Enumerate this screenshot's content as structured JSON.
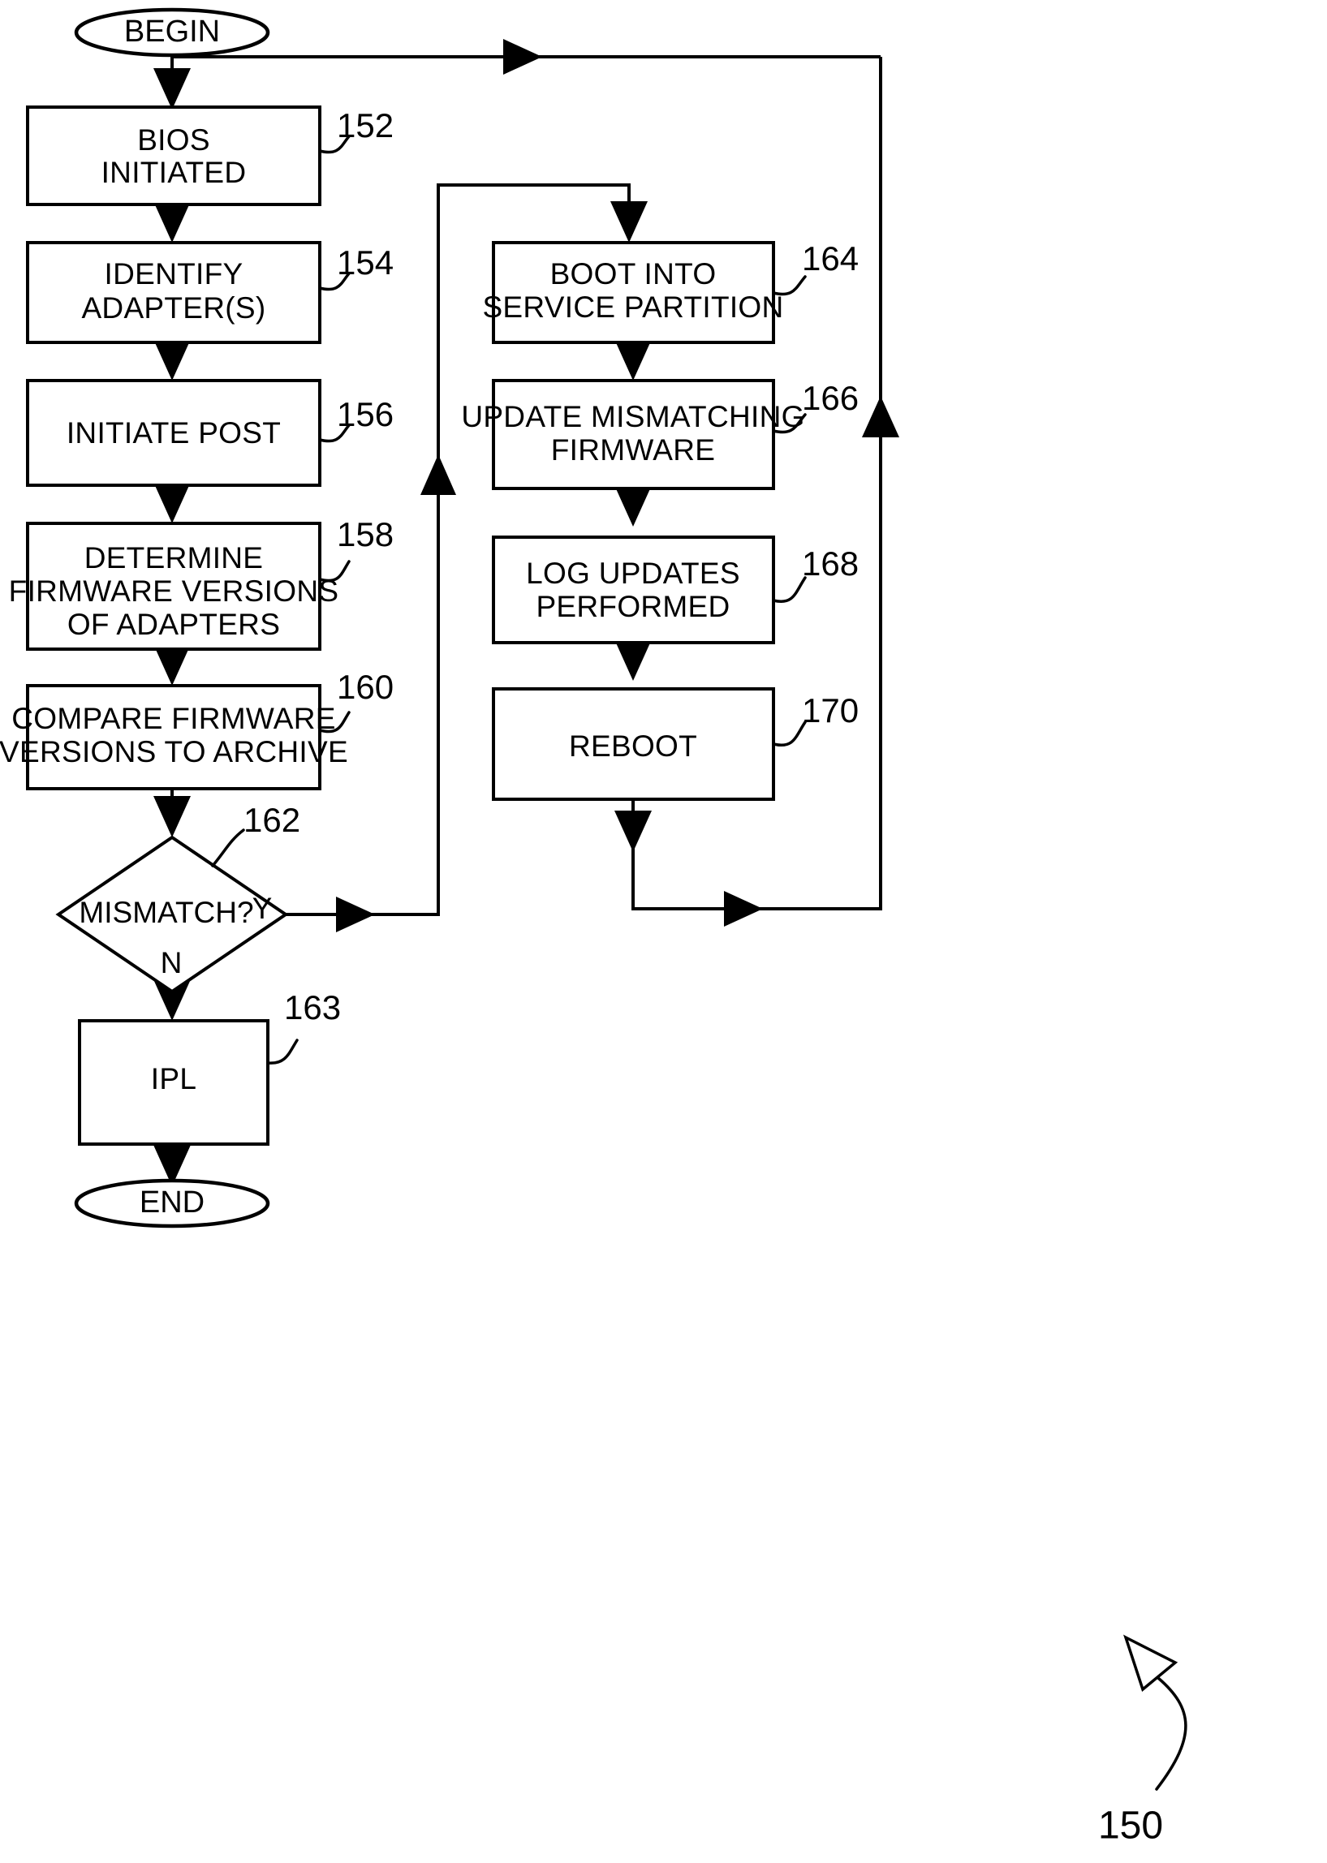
{
  "figure": {
    "number": "150",
    "type": "flowchart"
  },
  "terminators": {
    "begin": "BEGIN",
    "end": "END"
  },
  "left_column": [
    {
      "id": "152",
      "lines": [
        "BIOS",
        "INITIATED"
      ],
      "ref": "152"
    },
    {
      "id": "154",
      "lines": [
        "IDENTIFY",
        "ADAPTER(S)"
      ],
      "ref": "154"
    },
    {
      "id": "156",
      "lines": [
        "INITIATE POST"
      ],
      "ref": "156"
    },
    {
      "id": "158",
      "lines": [
        "DETERMINE",
        "FIRMWARE VERSIONS",
        "OF ADAPTERS"
      ],
      "ref": "158"
    },
    {
      "id": "160",
      "lines": [
        "COMPARE FIRMWARE",
        "VERSIONS TO ARCHIVE"
      ],
      "ref": "160"
    },
    {
      "id": "163",
      "lines": [
        "IPL"
      ],
      "ref": "163"
    }
  ],
  "decision": {
    "ref": "162",
    "question": "MISMATCH?",
    "yes_label": "Y",
    "no_label": "N"
  },
  "right_column": [
    {
      "id": "164",
      "lines": [
        "BOOT INTO",
        "SERVICE PARTITION"
      ],
      "ref": "164"
    },
    {
      "id": "166",
      "lines": [
        "UPDATE MISMATCHING",
        "FIRMWARE"
      ],
      "ref": "166"
    },
    {
      "id": "168",
      "lines": [
        "LOG UPDATES",
        "PERFORMED"
      ],
      "ref": "168"
    },
    {
      "id": "170",
      "lines": [
        "REBOOT"
      ],
      "ref": "170"
    }
  ],
  "chart_data": {
    "type": "diagram",
    "title": "Firmware update boot flow",
    "nodes": [
      {
        "ref": "",
        "label": "BEGIN",
        "shape": "terminator"
      },
      {
        "ref": "152",
        "label": "BIOS INITIATED",
        "shape": "process"
      },
      {
        "ref": "154",
        "label": "IDENTIFY ADAPTER(S)",
        "shape": "process"
      },
      {
        "ref": "156",
        "label": "INITIATE POST",
        "shape": "process"
      },
      {
        "ref": "158",
        "label": "DETERMINE FIRMWARE VERSIONS OF ADAPTERS",
        "shape": "process"
      },
      {
        "ref": "160",
        "label": "COMPARE FIRMWARE VERSIONS TO ARCHIVE",
        "shape": "process"
      },
      {
        "ref": "162",
        "label": "MISMATCH?",
        "shape": "decision"
      },
      {
        "ref": "163",
        "label": "IPL",
        "shape": "process"
      },
      {
        "ref": "",
        "label": "END",
        "shape": "terminator"
      },
      {
        "ref": "164",
        "label": "BOOT INTO SERVICE PARTITION",
        "shape": "process"
      },
      {
        "ref": "166",
        "label": "UPDATE MISMATCHING FIRMWARE",
        "shape": "process"
      },
      {
        "ref": "168",
        "label": "LOG UPDATES PERFORMED",
        "shape": "process"
      },
      {
        "ref": "170",
        "label": "REBOOT",
        "shape": "process"
      }
    ],
    "edges": [
      {
        "from": "BEGIN",
        "to": "152",
        "label": ""
      },
      {
        "from": "152",
        "to": "154",
        "label": ""
      },
      {
        "from": "154",
        "to": "156",
        "label": ""
      },
      {
        "from": "156",
        "to": "158",
        "label": ""
      },
      {
        "from": "158",
        "to": "160",
        "label": ""
      },
      {
        "from": "160",
        "to": "162",
        "label": ""
      },
      {
        "from": "162",
        "to": "164",
        "label": "Y"
      },
      {
        "from": "162",
        "to": "163",
        "label": "N"
      },
      {
        "from": "163",
        "to": "END",
        "label": ""
      },
      {
        "from": "164",
        "to": "166",
        "label": ""
      },
      {
        "from": "166",
        "to": "168",
        "label": ""
      },
      {
        "from": "168",
        "to": "170",
        "label": ""
      },
      {
        "from": "170",
        "to": "BEGIN",
        "label": ""
      }
    ]
  }
}
